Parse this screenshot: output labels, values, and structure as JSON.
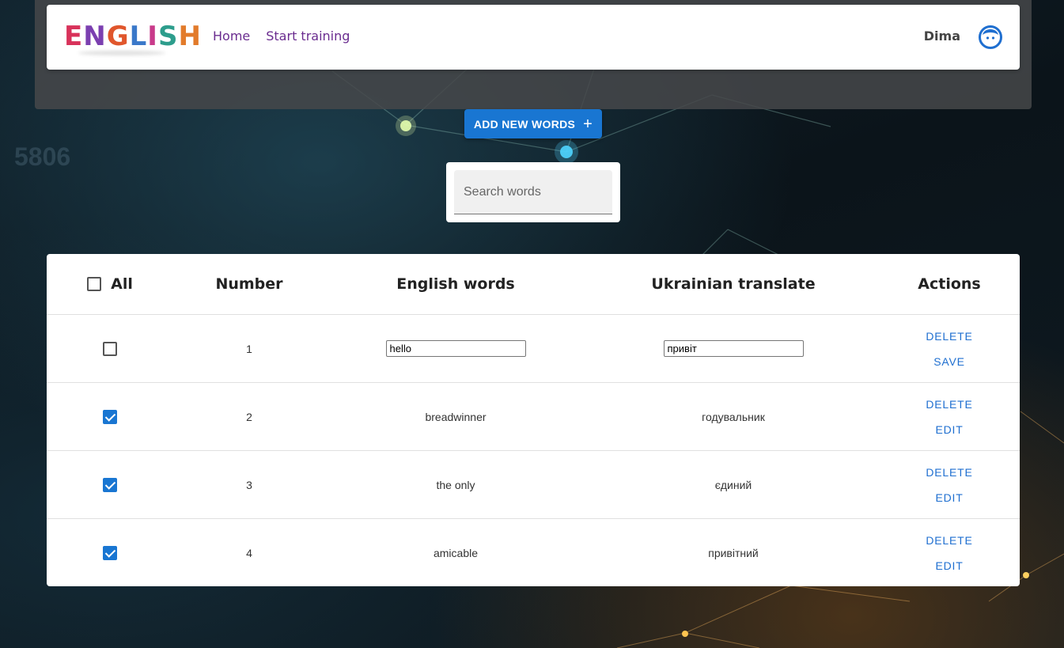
{
  "background": {
    "number_text": "5806"
  },
  "navbar": {
    "logo_text": "ENGLISH",
    "links": [
      "Home",
      "Start training"
    ],
    "user_name": "Dima",
    "avatar_icon": "face-icon"
  },
  "toolbar": {
    "add_label": "ADD NEW WORDS",
    "add_icon": "plus-icon"
  },
  "search": {
    "placeholder": "Search words",
    "value": ""
  },
  "table": {
    "headers": {
      "all": "All",
      "number": "Number",
      "english": "English words",
      "ukrainian": "Ukrainian translate",
      "actions": "Actions"
    },
    "rows": [
      {
        "number": "1",
        "english": "hello",
        "ukrainian": "привіт",
        "checked": false,
        "editing": true,
        "action1": "DELETE",
        "action2": "SAVE"
      },
      {
        "number": "2",
        "english": "breadwinner",
        "ukrainian": "годувальник",
        "checked": true,
        "editing": false,
        "action1": "DELETE",
        "action2": "EDIT"
      },
      {
        "number": "3",
        "english": "the only",
        "ukrainian": "єдиний",
        "checked": true,
        "editing": false,
        "action1": "DELETE",
        "action2": "EDIT"
      },
      {
        "number": "4",
        "english": "amicable",
        "ukrainian": "привітний",
        "checked": true,
        "editing": false,
        "action1": "DELETE",
        "action2": "EDIT"
      }
    ]
  },
  "colors": {
    "primary": "#1976d2",
    "nav_link": "#6a2c8f",
    "header_band": "#46484a"
  }
}
